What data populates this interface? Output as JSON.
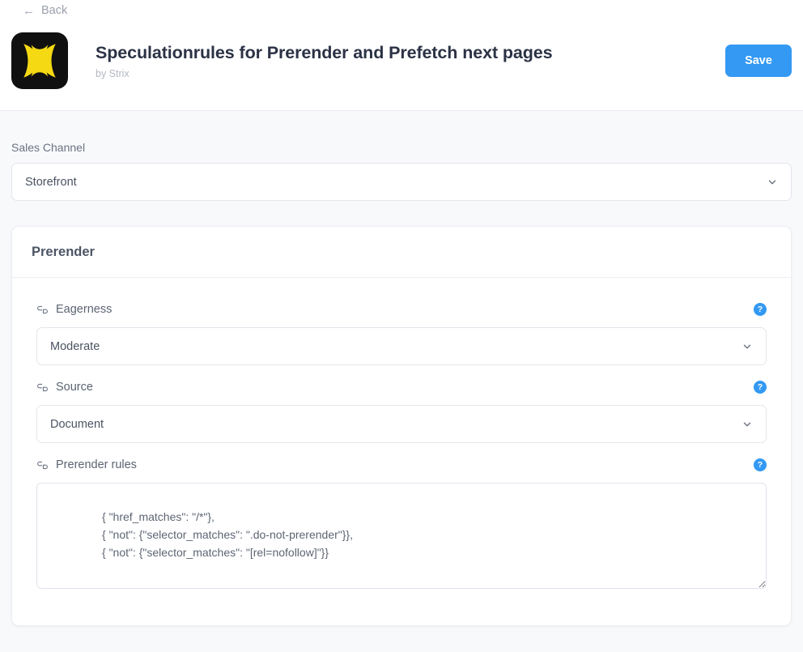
{
  "header": {
    "back_arrow": "←",
    "back_label": "Back",
    "app_title": "Speculationrules for Prerender and Prefetch next pages",
    "app_author": "by Strix",
    "save_label": "Save",
    "logo_icon": "butterfly-x-logo",
    "accent_color": "#3399f3",
    "logo_bg": "#101010",
    "logo_fg": "#f5d913"
  },
  "sales_channel": {
    "label": "Sales Channel",
    "value": "Storefront",
    "chevron_icon": "chevron-down-icon"
  },
  "card": {
    "title": "Prerender",
    "fields": [
      {
        "icon": "link-icon",
        "label": "Eagerness",
        "help_icon": "help-icon",
        "help_glyph": "?",
        "value": "Moderate",
        "chevron_icon": "chevron-down-icon"
      },
      {
        "icon": "link-icon",
        "label": "Source",
        "help_icon": "help-icon",
        "help_glyph": "?",
        "value": "Document",
        "chevron_icon": "chevron-down-icon"
      }
    ],
    "rules_field": {
      "icon": "link-icon",
      "label": "Prerender rules",
      "help_icon": "help-icon",
      "help_glyph": "?",
      "value": "{ \"href_matches\": \"/*\"},\n{ \"not\": {\"selector_matches\": \".do-not-prerender\"}},\n{ \"not\": {\"selector_matches\": \"[rel=nofollow]\"}}",
      "placeholder": ""
    }
  }
}
